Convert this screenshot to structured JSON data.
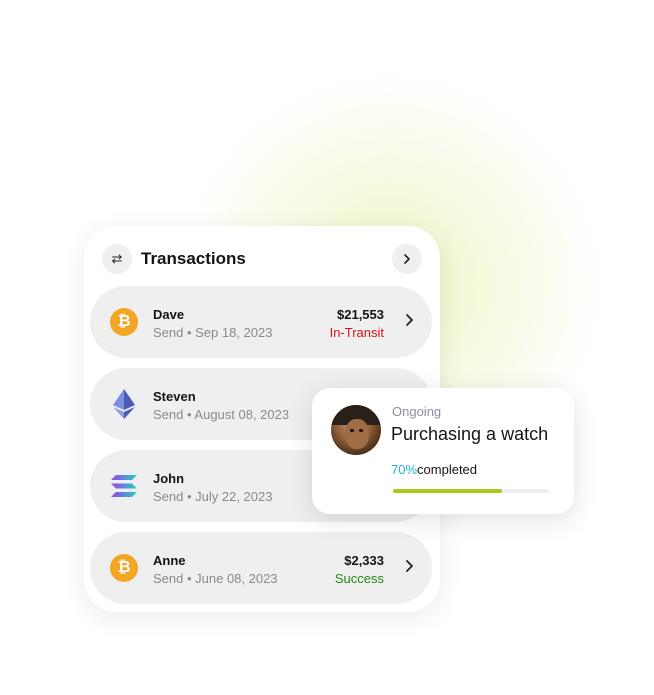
{
  "transactions": {
    "title": "Transactions",
    "swap_icon": "swap-arrows-icon",
    "next_icon": "chevron-right-icon",
    "items": [
      {
        "name": "Dave",
        "detail": "Send • Sep 18, 2023",
        "amount": "$21,553",
        "status": "In-Transit",
        "coin_icon": "bitcoin-icon",
        "status_color": "#d4161c"
      },
      {
        "name": "Steven",
        "detail": "Send • August 08, 2023",
        "amount": "",
        "status": "",
        "coin_icon": "ethereum-icon"
      },
      {
        "name": "John",
        "detail": "Send • July 22, 2023",
        "amount": "",
        "status": "",
        "coin_icon": "solana-icon"
      },
      {
        "name": "Anne",
        "detail": "Send • June 08, 2023",
        "amount": "$2,333",
        "status": "Success",
        "coin_icon": "bitcoin-icon",
        "status_color": "#1e8a16"
      }
    ]
  },
  "ongoing_card": {
    "label": "Ongoing",
    "title": "Purchasing a watch",
    "percent_text": "70%",
    "completed_text": "completed",
    "progress": 0.7,
    "percent_color": "#23b7d4",
    "bar_color": "#a7c81c"
  }
}
